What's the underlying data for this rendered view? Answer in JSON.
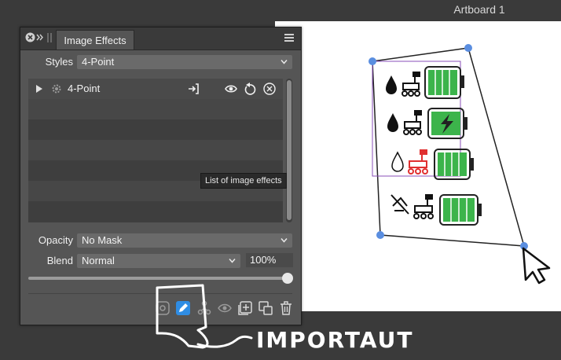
{
  "artboard": {
    "title": "Artboard 1"
  },
  "panel": {
    "tab_label": "Image Effects",
    "styles": {
      "label": "Styles",
      "value": "4-Point"
    },
    "effects_list": {
      "items": [
        {
          "label": "4-Point"
        }
      ],
      "tooltip": "List of image effects"
    },
    "opacity": {
      "label": "Opacity",
      "value": "No Mask"
    },
    "blend": {
      "label": "Blend",
      "value": "Normal",
      "percent": "100%"
    },
    "slider": {
      "value_fraction": 1.0
    }
  },
  "annotation": {
    "text": "IMPORTAUT"
  },
  "colors": {
    "background": "#3a3a3a",
    "panel": "#555555",
    "accent_blue": "#2f8de4",
    "handle_blue": "#5a8ee0",
    "battery_green": "#3cb44b",
    "selection_purple": "#8a4fb8",
    "rover_red": "#e03030"
  },
  "icons": [
    "close-icon",
    "collapse-icon",
    "menu-icon",
    "chevron-down-icon",
    "expand-arrow-icon",
    "gear-icon",
    "export-icon",
    "eye-icon",
    "reset-icon",
    "remove-icon",
    "add-effect-icon",
    "edit-effect-icon",
    "nodes-icon",
    "visibility-icon",
    "add-icon",
    "duplicate-icon",
    "trash-icon",
    "mouse-pointer-icon"
  ]
}
